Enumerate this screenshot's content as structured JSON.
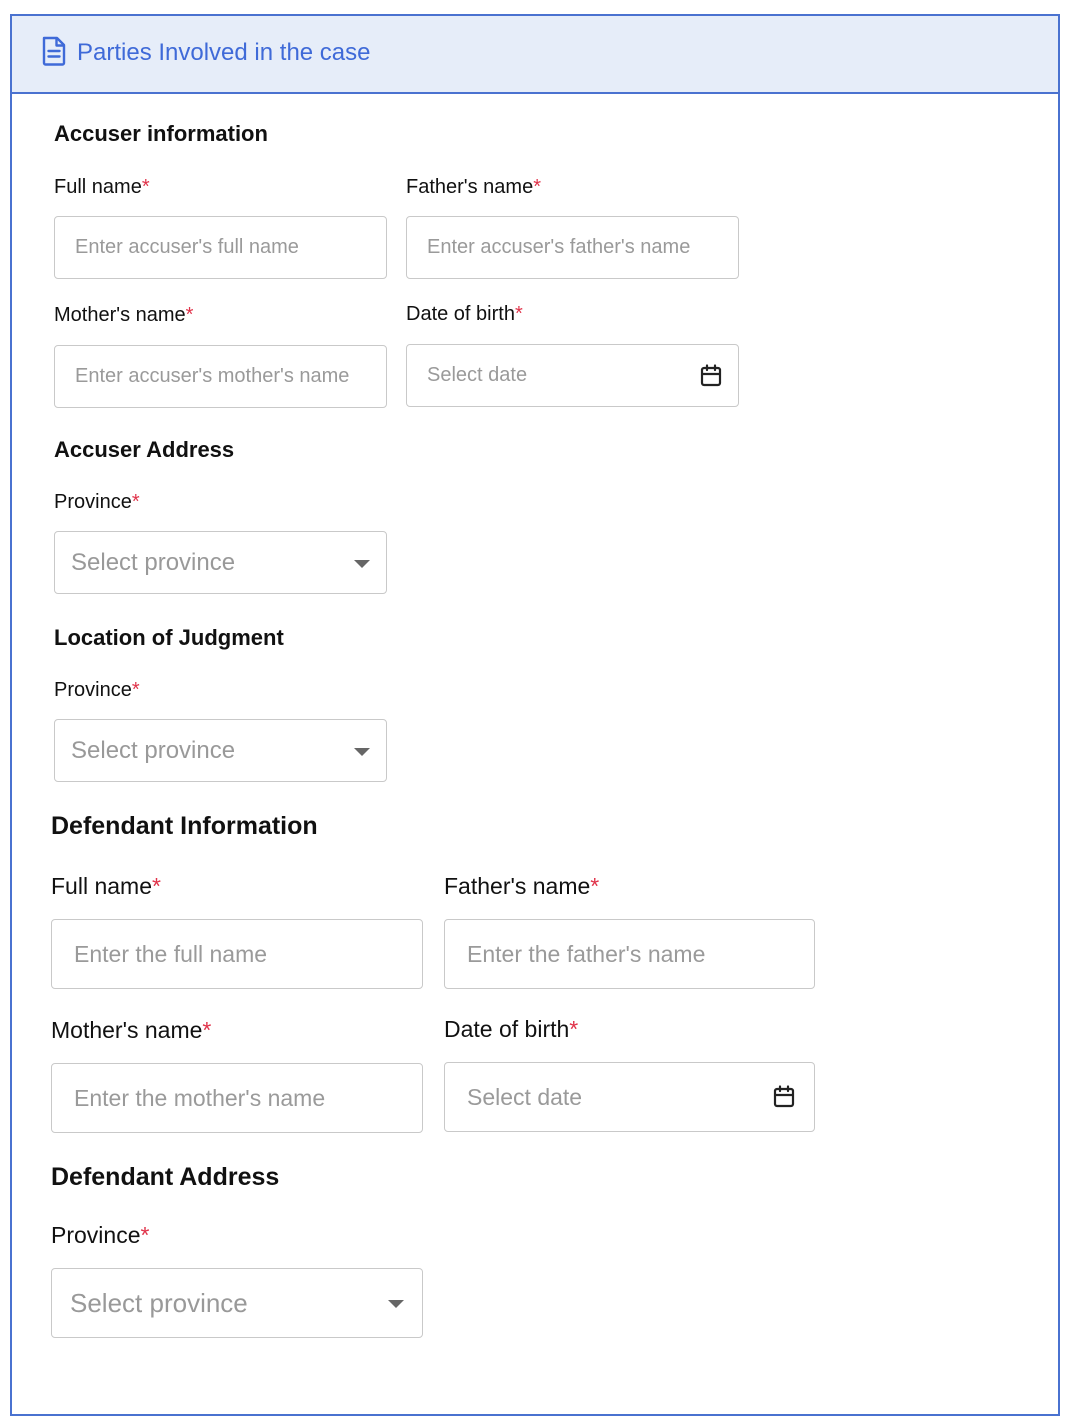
{
  "header": {
    "title": "Parties Involved in the case",
    "icon": "document-icon"
  },
  "required_marker": "*",
  "accuser": {
    "title": "Accuser information",
    "full_name": {
      "label": "Full name",
      "placeholder": "Enter accuser's full name"
    },
    "father_name": {
      "label": "Father's name",
      "placeholder": "Enter accuser's father's name"
    },
    "mother_name": {
      "label": "Mother's name",
      "placeholder": "Enter accuser's mother's name"
    },
    "dob": {
      "label": "Date of birth",
      "placeholder": "Select date"
    }
  },
  "accuser_address": {
    "title": "Accuser Address",
    "province": {
      "label": "Province",
      "placeholder": "Select province"
    }
  },
  "judgment_location": {
    "title": "Location of Judgment",
    "province": {
      "label": "Province",
      "placeholder": "Select province"
    }
  },
  "defendant": {
    "title": "Defendant Information",
    "full_name": {
      "label": "Full name",
      "placeholder": "Enter the full name"
    },
    "father_name": {
      "label": "Father's name",
      "placeholder": "Enter the father's name"
    },
    "mother_name": {
      "label": "Mother's name",
      "placeholder": "Enter the mother's name"
    },
    "dob": {
      "label": "Date of birth",
      "placeholder": "Select date"
    }
  },
  "defendant_address": {
    "title": "Defendant Address",
    "province": {
      "label": "Province",
      "placeholder": "Select province"
    }
  }
}
